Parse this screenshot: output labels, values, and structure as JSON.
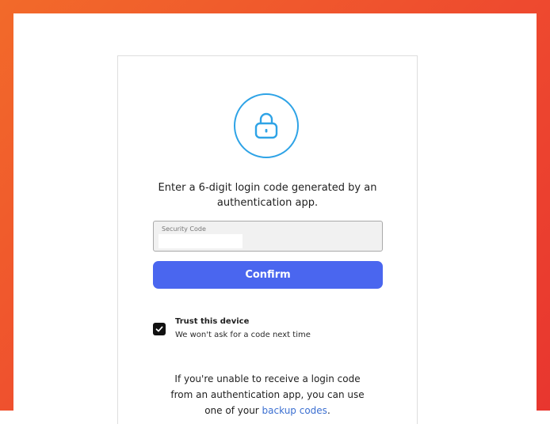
{
  "auth": {
    "instruction_line1": "Enter a 6-digit login code generated by an",
    "instruction_line2": "authentication app.",
    "code_field": {
      "label": "Security Code",
      "value": ""
    },
    "confirm_label": "Confirm",
    "trust": {
      "checked": true,
      "title": "Trust this device",
      "subtitle": "We won't ask for a code next time"
    },
    "fallback": {
      "line1": "If you're unable to receive a login code",
      "line2": "from an authentication app, you can use",
      "line3_prefix": "one of your ",
      "link_text": "backup codes",
      "line3_suffix": "."
    }
  },
  "colors": {
    "frame": "#ee4a2f",
    "accent_ring": "#2ea3e6",
    "button": "#4a66ef",
    "link": "#3b6fd1",
    "checkbox": "#111111"
  },
  "icons": {
    "lock": "lock-icon",
    "check": "check-icon"
  }
}
